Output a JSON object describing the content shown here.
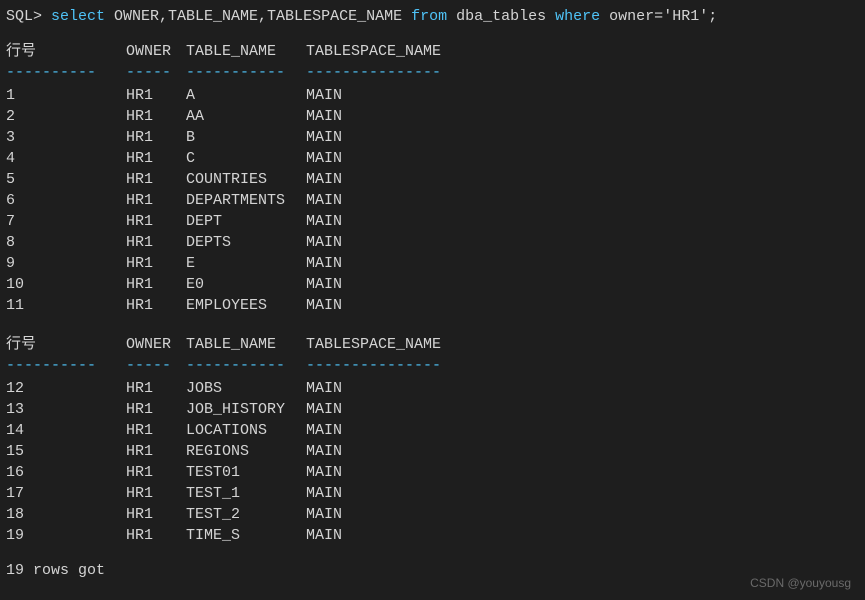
{
  "prompt": "SQL> ",
  "query_parts": {
    "select": "select",
    "columns": " OWNER,TABLE_NAME,TABLESPACE_NAME ",
    "from": "from",
    "table": " dba_tables ",
    "where": "where",
    "condition_col": " owner",
    "equals": "=",
    "value": "'HR1'",
    "semicolon": ";"
  },
  "headers": {
    "rownum": "行号",
    "owner": "OWNER",
    "table_name": "TABLE_NAME",
    "tablespace_name": "TABLESPACE_NAME"
  },
  "dashes": {
    "rownum": "----------",
    "owner": "-----",
    "table_name": "-----------",
    "tablespace_name": "---------------"
  },
  "block1": [
    {
      "n": "1",
      "owner": "HR1",
      "table": "A",
      "ts": "MAIN"
    },
    {
      "n": "2",
      "owner": "HR1",
      "table": "AA",
      "ts": "MAIN"
    },
    {
      "n": "3",
      "owner": "HR1",
      "table": "B",
      "ts": "MAIN"
    },
    {
      "n": "4",
      "owner": "HR1",
      "table": "C",
      "ts": "MAIN"
    },
    {
      "n": "5",
      "owner": "HR1",
      "table": "COUNTRIES",
      "ts": "MAIN"
    },
    {
      "n": "6",
      "owner": "HR1",
      "table": "DEPARTMENTS",
      "ts": "MAIN"
    },
    {
      "n": "7",
      "owner": "HR1",
      "table": "DEPT",
      "ts": "MAIN"
    },
    {
      "n": "8",
      "owner": "HR1",
      "table": "DEPTS",
      "ts": "MAIN"
    },
    {
      "n": "9",
      "owner": "HR1",
      "table": "E",
      "ts": "MAIN"
    },
    {
      "n": "10",
      "owner": "HR1",
      "table": "E0",
      "ts": "MAIN"
    },
    {
      "n": "11",
      "owner": "HR1",
      "table": "EMPLOYEES",
      "ts": "MAIN"
    }
  ],
  "block2": [
    {
      "n": "12",
      "owner": "HR1",
      "table": "JOBS",
      "ts": "MAIN"
    },
    {
      "n": "13",
      "owner": "HR1",
      "table": "JOB_HISTORY",
      "ts": "MAIN"
    },
    {
      "n": "14",
      "owner": "HR1",
      "table": "LOCATIONS",
      "ts": "MAIN"
    },
    {
      "n": "15",
      "owner": "HR1",
      "table": "REGIONS",
      "ts": "MAIN"
    },
    {
      "n": "16",
      "owner": "HR1",
      "table": "TEST01",
      "ts": "MAIN"
    },
    {
      "n": "17",
      "owner": "HR1",
      "table": "TEST_1",
      "ts": "MAIN"
    },
    {
      "n": "18",
      "owner": "HR1",
      "table": "TEST_2",
      "ts": "MAIN"
    },
    {
      "n": "19",
      "owner": "HR1",
      "table": "TIME_S",
      "ts": "MAIN"
    }
  ],
  "footer": "19 rows got",
  "watermark": "CSDN @youyousg"
}
